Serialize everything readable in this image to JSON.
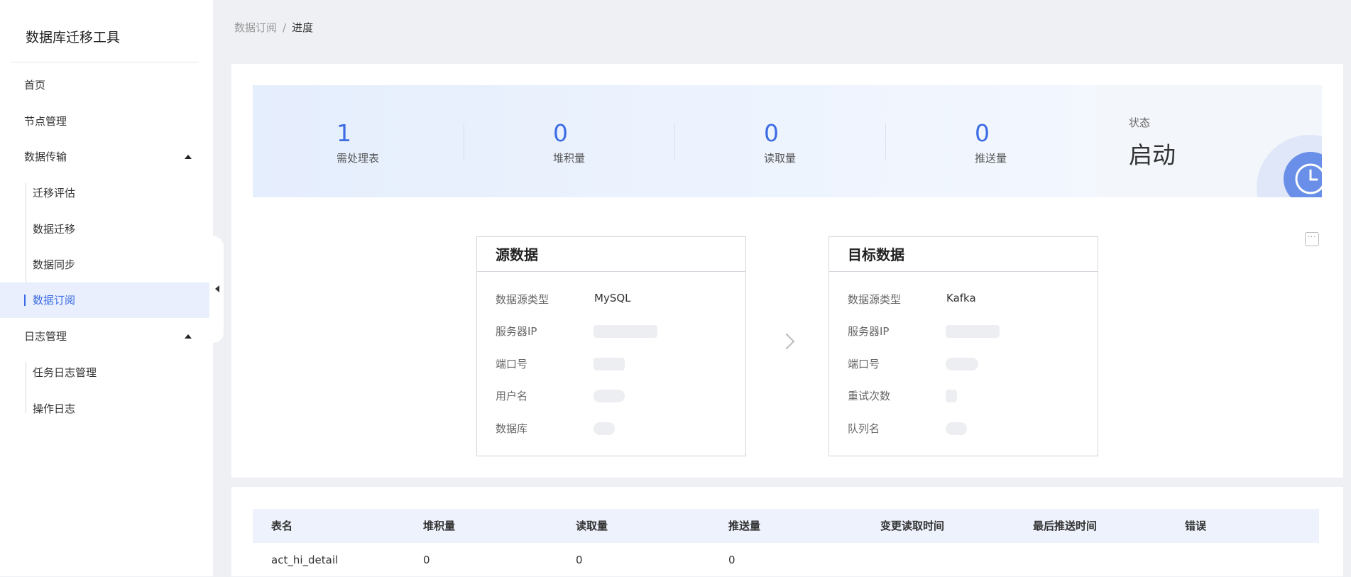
{
  "app": {
    "title": "数据库迁移工具"
  },
  "sidebar": {
    "items": [
      {
        "label": "首页"
      },
      {
        "label": "节点管理"
      },
      {
        "label": "数据传输",
        "children": [
          "迁移评估",
          "数据迁移",
          "数据同步",
          "数据订阅"
        ]
      },
      {
        "label": "日志管理",
        "children": [
          "任务日志管理",
          "操作日志"
        ]
      }
    ],
    "active": "数据订阅"
  },
  "breadcrumb": {
    "parent": "数据订阅",
    "separator": "/",
    "current": "进度"
  },
  "stats": [
    {
      "value": "1",
      "label": "需处理表"
    },
    {
      "value": "0",
      "label": "堆积量"
    },
    {
      "value": "0",
      "label": "读取量"
    },
    {
      "value": "0",
      "label": "推送量"
    }
  ],
  "status": {
    "label": "状态",
    "value": "启动"
  },
  "source_card": {
    "title": "源数据",
    "fields": [
      "数据源类型",
      "服务器IP",
      "端口号",
      "用户名",
      "数据库"
    ],
    "type_value": "MySQL"
  },
  "target_card": {
    "title": "目标数据",
    "fields": [
      "数据源类型",
      "服务器IP",
      "端口号",
      "重试次数",
      "队列名"
    ],
    "type_value": "Kafka"
  },
  "more_button": {
    "label": "···"
  },
  "table": {
    "columns": [
      "表名",
      "堆积量",
      "读取量",
      "推送量",
      "变更读取时间",
      "最后推送时间",
      "错误"
    ],
    "rows": [
      [
        "act_hi_detail",
        "0",
        "0",
        "0",
        "",
        "",
        ""
      ]
    ]
  },
  "colors": {
    "accent": "#3c6ce4",
    "background": "#eef0f4",
    "active_bg": "#e9effd"
  }
}
